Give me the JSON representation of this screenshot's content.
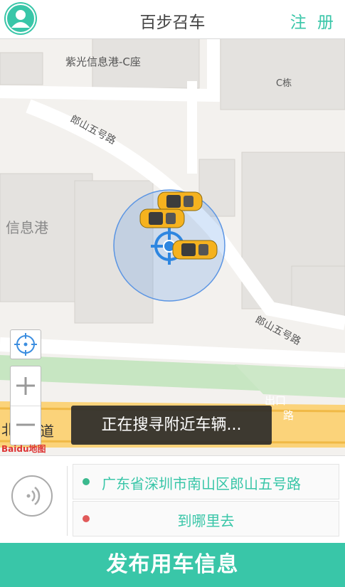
{
  "header": {
    "title": "百步召车",
    "register_label": "注 册"
  },
  "map": {
    "labels": {
      "building_c": "紫光信息港-C座",
      "building_cdong": "C栋",
      "info_port": "信息港",
      "road_top": "郎山五号路",
      "road_bottom": "郎山五号路",
      "exit_label": "出口",
      "exit_road": "路",
      "road_left": "北",
      "road_left2": "道"
    },
    "baidu": "Baidu地图",
    "nearby_cars": 3
  },
  "toast": "正在搜寻附近车辆...",
  "route": {
    "from": "广东省深圳市南山区郎山五号路",
    "to": "到哪里去",
    "from_color": "#3bb98e",
    "to_color": "#e15a5a"
  },
  "publish_label": "发布用车信息",
  "colors": {
    "accent": "#39c6a8"
  }
}
